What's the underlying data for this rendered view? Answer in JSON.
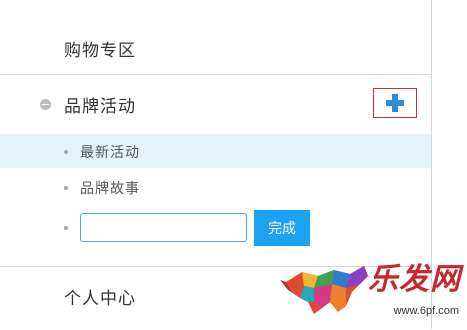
{
  "menu": {
    "shopping": "购物专区",
    "brand_activity": "品牌活动",
    "sub_items": [
      {
        "label": "最新活动"
      },
      {
        "label": "品牌故事"
      }
    ],
    "new_item_input": {
      "value": "",
      "placeholder": ""
    },
    "done_button": "完成",
    "personal_center": "个人中心"
  },
  "watermark": {
    "brand": "乐发网",
    "url": "www.6pf.com"
  },
  "colors": {
    "accent_blue": "#1da1f2",
    "plus_blue": "#2b8fd6",
    "highlight_row": "#e6f2f9",
    "plus_border_red": "#d32f2f"
  },
  "icons": {
    "add": "plus-icon",
    "collapse": "minus-circle-icon",
    "logo": "bull-logo"
  }
}
